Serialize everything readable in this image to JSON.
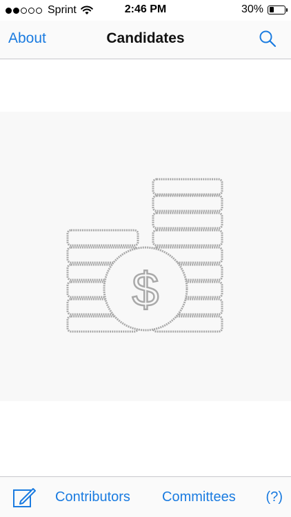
{
  "status_bar": {
    "carrier": "Sprint",
    "time": "2:46 PM",
    "battery_percent": "30%",
    "battery_level": 0.3,
    "signal_bars_filled": 2,
    "signal_bars_total": 5
  },
  "nav": {
    "left_label": "About",
    "title": "Candidates",
    "search_icon": "search-icon"
  },
  "illustration": {
    "icon": "coin-stacks-dollar-icon",
    "symbol": "$"
  },
  "toolbar": {
    "compose_icon": "compose-icon",
    "contributors_label": "Contributors",
    "committees_label": "Committees",
    "help_label": "(?)"
  },
  "colors": {
    "accent": "#1a7be0",
    "illustration_stroke": "#a9a9a9",
    "illustration_bg": "#f8f8f8"
  }
}
